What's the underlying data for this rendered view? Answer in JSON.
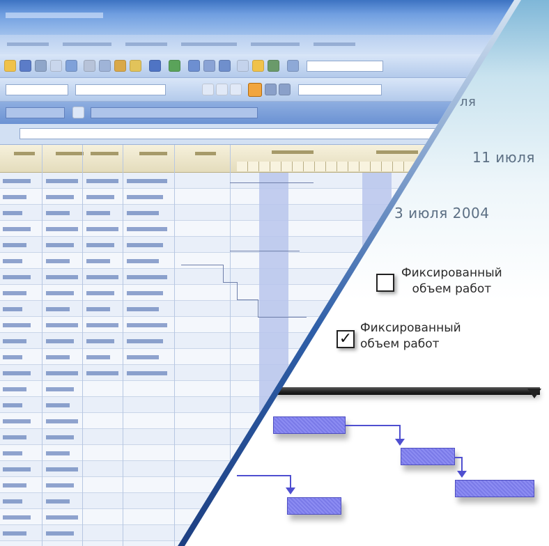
{
  "timeline": {
    "dates": [
      {
        "label": "ля"
      },
      {
        "label": "11 июля"
      },
      {
        "label": "3 июля 2004"
      }
    ]
  },
  "options": {
    "unchecked": {
      "label_line1": "Фиксированный",
      "label_line2": "объем работ",
      "checked": false
    },
    "checked": {
      "label_line1": "Фиксированный",
      "label_line2": "объем работ",
      "checked": true,
      "mark": "✓"
    }
  },
  "colors": {
    "title_bar": "#3d73c2",
    "toolbar": "#c7d8f1",
    "grid_header": "#efe8cc",
    "gantt_stripe": "#b9c6ec",
    "task_bar": "#8585ee",
    "summary_bar": "#222222",
    "link": "#4f4fd0"
  },
  "icons": [
    "save-icon",
    "print-icon",
    "cut-icon",
    "copy-icon",
    "paste-icon",
    "undo-icon",
    "link-icon",
    "bold-icon",
    "italic-icon",
    "underline-icon",
    "align-icon",
    "calendar-icon"
  ]
}
